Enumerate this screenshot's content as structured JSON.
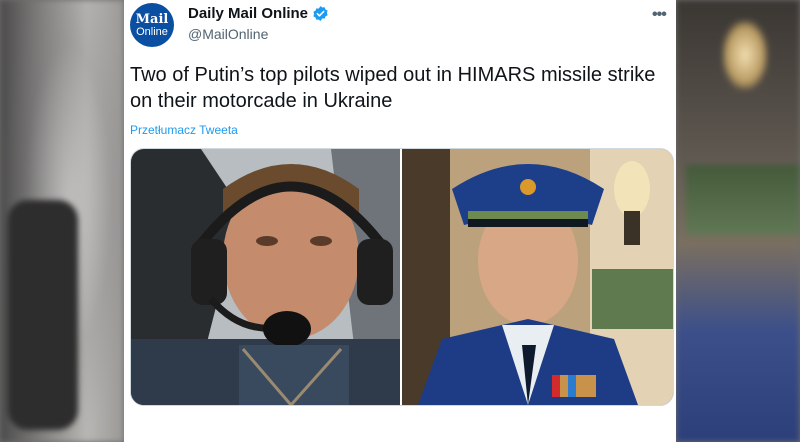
{
  "tweet": {
    "avatar": {
      "line1": "Mail",
      "line2": "Online"
    },
    "display_name": "Daily Mail Online",
    "handle": "@MailOnline",
    "more_label": "•••",
    "text": "Two of Putin’s top pilots wiped out in HIMARS missile strike on their motorcade in Ukraine",
    "translate_link": "Przetłumacz Tweeta"
  },
  "colors": {
    "brand_blue": "#0b4fa3",
    "verified": "#1d9bf0",
    "link": "#1d9bf0",
    "text": "#0f1419",
    "muted": "#536471"
  },
  "icons": {
    "verified": "verified-badge-icon",
    "more": "more-options-icon"
  }
}
